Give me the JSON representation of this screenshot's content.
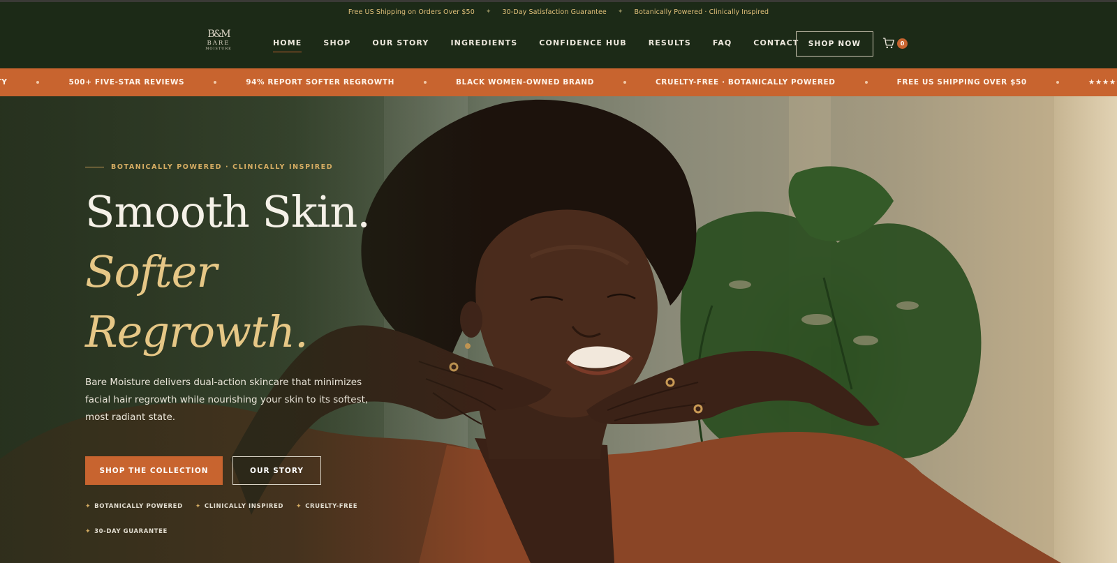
{
  "announcement": {
    "items": [
      "Free US Shipping on Orders Over $50",
      "30-Day Satisfaction Guarantee",
      "Botanically Powered · Clinically Inspired"
    ],
    "separator": "✦"
  },
  "logo": {
    "monogram": "B&M",
    "word1": "BARE",
    "word2": "MOISTURE"
  },
  "nav": {
    "items": [
      "HOME",
      "SHOP",
      "OUR STORY",
      "INGREDIENTS",
      "CONFIDENCE HUB",
      "RESULTS",
      "FAQ",
      "CONTACT"
    ],
    "active": "HOME"
  },
  "header": {
    "shop_now_label": "SHOP NOW",
    "cart_count": "0"
  },
  "marquee": {
    "items": [
      "ITY",
      "500+ FIVE-STAR REVIEWS",
      "94% REPORT SOFTER REGROWTH",
      "BLACK WOMEN-OWNED BRAND",
      "CRUELTY-FREE · BOTANICALLY POWERED",
      "FREE US SHIPPING OVER $50",
      "★★★★★ LOVED BY OUR COMMUNITY"
    ]
  },
  "hero": {
    "eyebrow": "BOTANICALLY POWERED · CLINICALLY INSPIRED",
    "headline_line1": "Smooth Skin.",
    "headline_line2": "Softer",
    "headline_line3": "Regrowth.",
    "description": "Bare Moisture delivers dual-action skincare that minimizes facial hair regrowth while nourishing your skin to its softest, most radiant state.",
    "primary_cta": "SHOP THE COLLECTION",
    "secondary_cta": "OUR STORY",
    "badges": [
      "BOTANICALLY POWERED",
      "CLINICALLY INSPIRED",
      "CRUELTY-FREE",
      "30-DAY GUARANTEE"
    ]
  },
  "colors": {
    "header_bg": "#1c2a17",
    "accent": "#c8642f",
    "gold": "#e6c786"
  }
}
